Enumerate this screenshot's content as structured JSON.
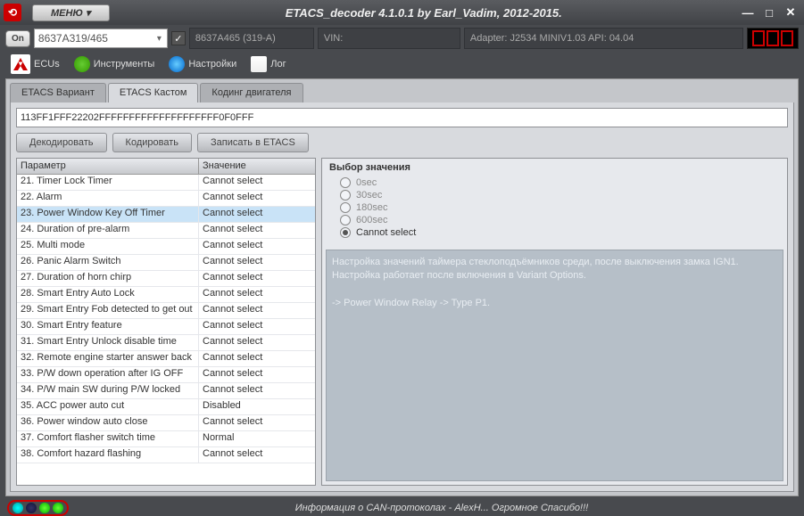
{
  "titlebar": {
    "menu": "МЕНЮ",
    "menu_arrow": "▾",
    "title": "ETACS_decoder 4.1.0.1 by Earl_Vadim, 2012-2015.",
    "min": "—",
    "max": "□",
    "close": "✕"
  },
  "info": {
    "on": "On",
    "combo": "8637A319/465",
    "check": "✓",
    "field1": "8637A465   (319-A)",
    "field2_label": "VIN:",
    "field3_label": "Adapter: J2534 MINIV1.03 API: 04.04"
  },
  "maintabs": {
    "ecus": "ECUs",
    "tools": "Инструменты",
    "settings": "Настройки",
    "log": "Лог"
  },
  "subtabs": {
    "t1": "ETACS Вариант",
    "t2": "ETACS Кастом",
    "t3": "Кодинг двигателя"
  },
  "hex": "113FF1FFF22202FFFFFFFFFFFFFFFFFFFF0F0FFF",
  "buttons": {
    "decode": "Декодировать",
    "encode": "Кодировать",
    "write": "Записать в ETACS"
  },
  "table": {
    "h_param": "Параметр",
    "h_val": "Значение",
    "rows": [
      {
        "p": "21. Timer Lock Timer",
        "v": "Cannot select"
      },
      {
        "p": "22. Alarm",
        "v": "Cannot select"
      },
      {
        "p": "23. Power Window Key Off Timer",
        "v": "Cannot select"
      },
      {
        "p": "24. Duration of pre-alarm",
        "v": "Cannot select"
      },
      {
        "p": "25. Multi mode",
        "v": "Cannot select"
      },
      {
        "p": "26. Panic Alarm Switch",
        "v": "Cannot select"
      },
      {
        "p": "27. Duration of horn chirp",
        "v": "Cannot select"
      },
      {
        "p": "28. Smart Entry Auto Lock",
        "v": "Cannot select"
      },
      {
        "p": "29. Smart Entry Fob detected to get out",
        "v": "Cannot select"
      },
      {
        "p": "30. Smart Entry feature",
        "v": "Cannot select"
      },
      {
        "p": "31. Smart Entry Unlock disable time",
        "v": "Cannot select"
      },
      {
        "p": "32. Remote engine starter answer back",
        "v": "Cannot select"
      },
      {
        "p": "33. P/W down operation after IG OFF",
        "v": "Cannot select"
      },
      {
        "p": "34. P/W main SW during P/W locked",
        "v": "Cannot select"
      },
      {
        "p": "35. ACC power auto cut",
        "v": "Disabled"
      },
      {
        "p": "36. Power window auto close",
        "v": "Cannot select"
      },
      {
        "p": "37. Comfort flasher switch time",
        "v": "Normal"
      },
      {
        "p": "38. Comfort hazard flashing",
        "v": "Cannot select"
      }
    ],
    "selected_index": 2
  },
  "right": {
    "group": "Выбор значения",
    "opts": [
      "0sec",
      "30sec",
      "180sec",
      "600sec",
      "Cannot select"
    ],
    "sel": 4,
    "help1": "Настройка значений таймера стеклоподъёмников среди, после выключения замка IGN1.",
    "help2": "Настройка работает после включения в Variant Options.",
    "help3": "-> Power Window Relay -> Type P1."
  },
  "status": {
    "text": "Информация о CAN-протоколах - AlexH... Огромное Спасибо!!!"
  }
}
